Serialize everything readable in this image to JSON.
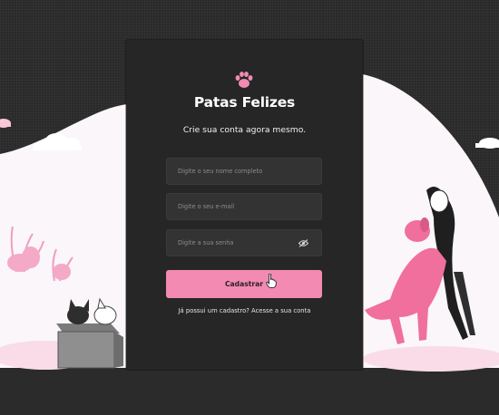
{
  "brand": {
    "name": "Patas Felizes"
  },
  "form": {
    "subtitle": "Crie sua conta agora mesmo.",
    "name_placeholder": "Digite o seu nome completo",
    "email_placeholder": "Digite o seu e-mail",
    "password_placeholder": "Digite a sua senha",
    "submit_label": "Cadastrar",
    "login_text": "Já possui um cadastro? Acesse a sua conta"
  },
  "colors": {
    "accent": "#f28ab2",
    "card": "#262626",
    "background": "#2a2a2a"
  },
  "icons": [
    "paw-icon",
    "eye-slash-icon",
    "hand-pointer-cursor-icon"
  ]
}
